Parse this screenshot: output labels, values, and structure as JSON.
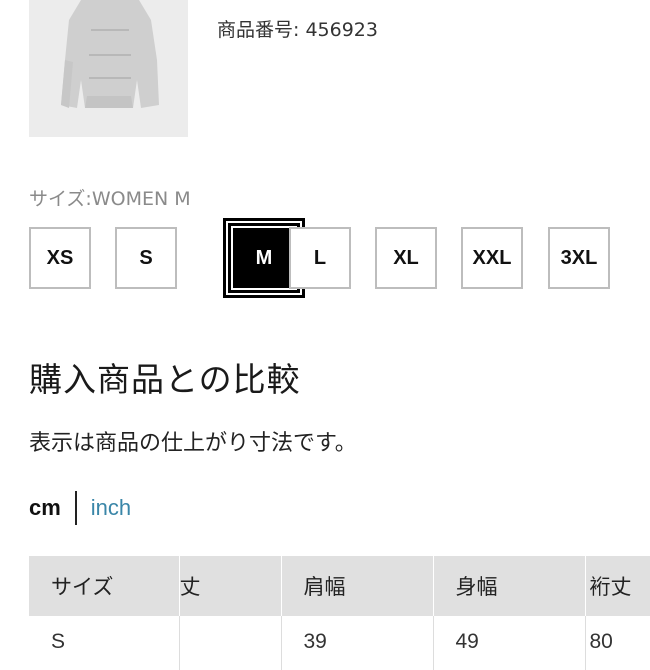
{
  "product": {
    "number_label": "商品番号: 456923"
  },
  "size_selector": {
    "caption": "サイズ:WOMEN M",
    "options": [
      "XS",
      "S",
      "M",
      "L",
      "XL",
      "XXL",
      "3XL"
    ],
    "selected": "M"
  },
  "comparison": {
    "title": "購入商品との比較",
    "note": "表示は商品の仕上がり寸法です。"
  },
  "units": {
    "cm": "cm",
    "inch": "inch",
    "active": "cm"
  },
  "size_table": {
    "headers": [
      "サイズ",
      "丈",
      "肩幅",
      "身幅",
      "裄丈"
    ],
    "rows": [
      [
        "S",
        "",
        "39",
        "49",
        "80"
      ]
    ]
  },
  "colors": {
    "selected_bg": "#000000",
    "link": "#3a86a8",
    "table_header_bg": "#e0e0e0"
  }
}
